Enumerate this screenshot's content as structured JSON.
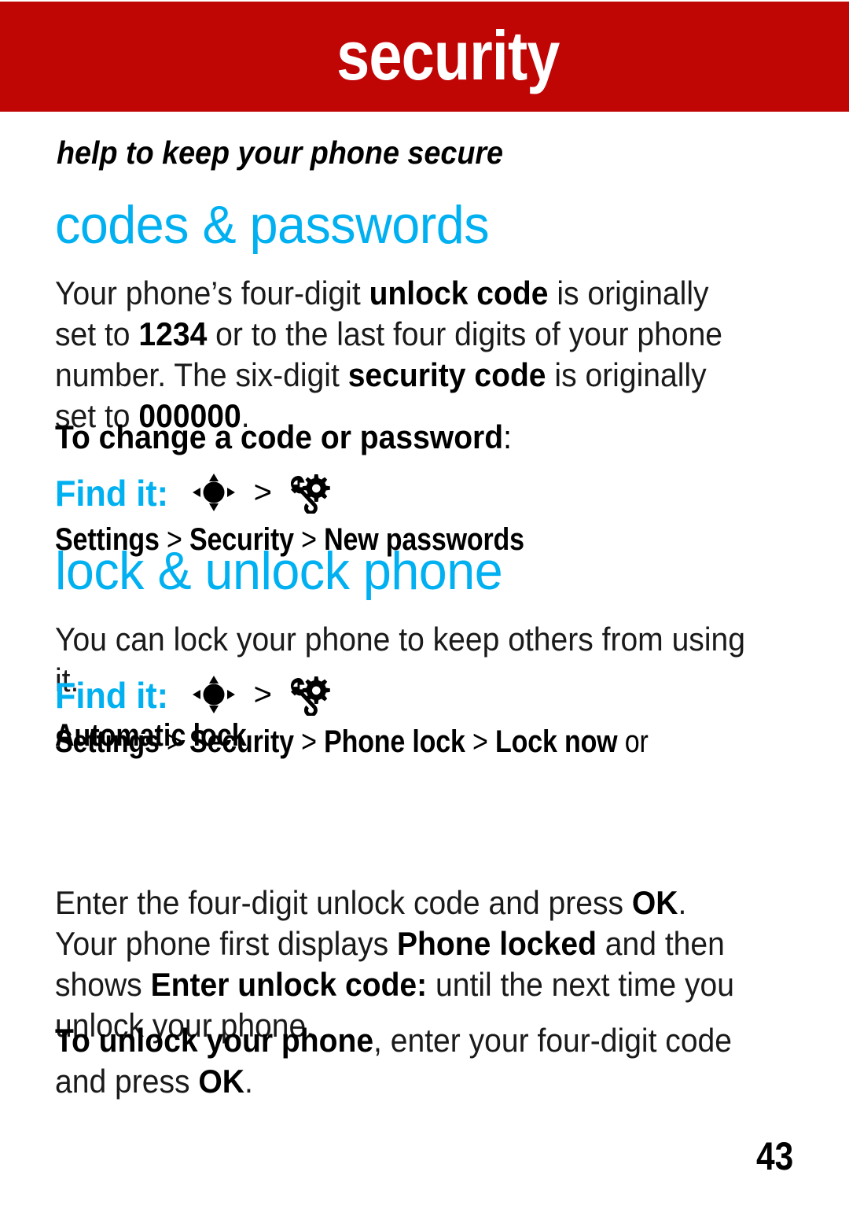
{
  "banner": {
    "title": "security",
    "background_color": "#c00505",
    "title_color": "#ffffff"
  },
  "subtitle": "help to keep your phone secure",
  "accent_color": "#00b0f0",
  "sections": [
    {
      "heading": "codes & passwords",
      "paragraph_html": "Your phone’s four-digit <b>unlock code</b> is originally set to <b>1234</b> or to the last four digits of your phone number. The six-digit <b>security code</b> is originally set to <b>000000</b>.",
      "lead_html": "To change a code or password<span class=\"thin\">:</span>",
      "findit": {
        "label": "Find it:",
        "nav_icon": "five-way-navigation-key-icon",
        "settings_icon": "wrench-gear-settings-icon",
        "separator": ">",
        "path_html": "Settings <span class=\"reg\">&gt;</span> Security <span class=\"reg\">&gt;</span> New passwords"
      }
    },
    {
      "heading": "lock & unlock phone",
      "paragraph_html": "You can lock your phone to keep others from using it.",
      "findit": {
        "label": "Find it:",
        "nav_icon": "five-way-navigation-key-icon",
        "settings_icon": "wrench-gear-settings-icon",
        "separator": ">",
        "path_html": "Settings <span class=\"reg\">&gt;</span> Security <span class=\"reg\">&gt;</span> Phone lock <span class=\"reg\">&gt;</span> Lock now <span class=\"reg\">or</span>",
        "continuation": "Automatic lock"
      },
      "body_html": "Enter the four-digit unlock code and press <b>OK</b>. Your phone first displays <b>Phone locked</b> and then shows <b>Enter unlock code:</b> until the next time you unlock your phone.",
      "closing_html": "<b>To unlock your phone</b>, enter your four-digit code and press <b>OK</b>."
    }
  ],
  "page_number": "43"
}
